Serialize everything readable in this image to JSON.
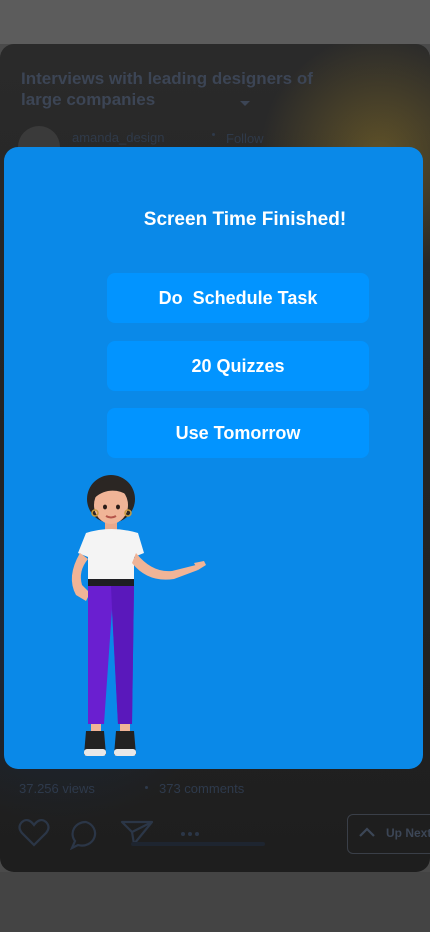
{
  "post": {
    "title": "Interviews with leading designers of large companies",
    "author": "amanda_design",
    "follow_label": "Follow",
    "views": "37.256 views",
    "comments": "373 comments",
    "up_next_label": "Up Next"
  },
  "modal": {
    "title": "Screen Time Finished!",
    "buttons": {
      "schedule": "Do  Schedule Task",
      "quizzes": "20 Quizzes",
      "tomorrow": "Use Tomorrow"
    }
  },
  "icons": {
    "like": "heart-icon",
    "comment": "comment-icon",
    "share": "send-icon",
    "more": "more-icon",
    "up_next": "chevron-up-icon"
  },
  "colors": {
    "modal_bg": "#0a89e8",
    "button_bg": "#0294ff",
    "text": "#ffffff"
  }
}
